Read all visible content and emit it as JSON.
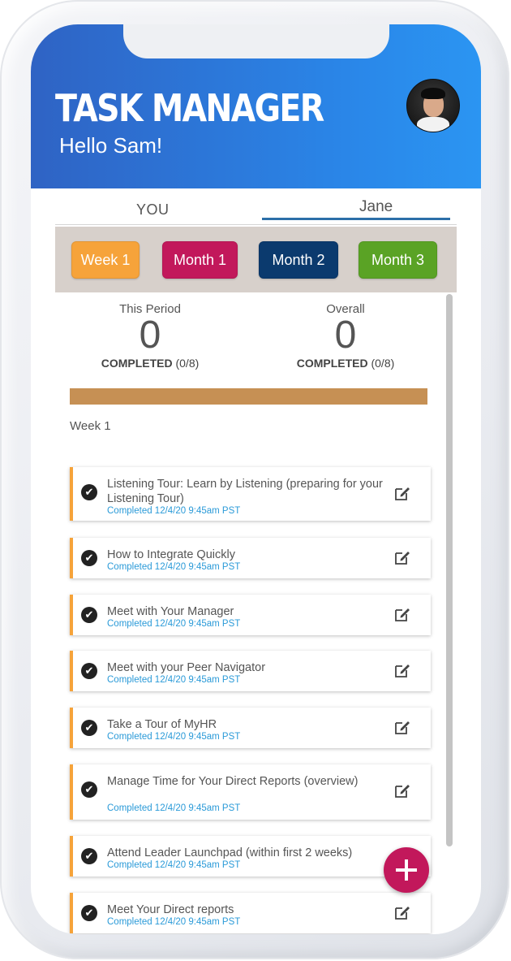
{
  "app": {
    "title": "TASK MANAGER",
    "greeting": "Hello Sam!"
  },
  "tabs": [
    {
      "label": "YOU",
      "active": false
    },
    {
      "label": "Jane",
      "active": true
    }
  ],
  "periods": [
    {
      "label": "Week 1",
      "color": "#f6a33a"
    },
    {
      "label": "Month 1",
      "color": "#c2185b"
    },
    {
      "label": "Month 2",
      "color": "#0b3a6e"
    },
    {
      "label": "Month 3",
      "color": "#5aa325"
    }
  ],
  "stats": {
    "this_period": {
      "label": "This Period",
      "value": "0",
      "completed_label": "COMPLETED",
      "completed_count": "(0/8)"
    },
    "overall": {
      "label": "Overall",
      "value": "0",
      "completed_label": "COMPLETED",
      "completed_count": "(0/8)"
    }
  },
  "progress": {
    "fraction": 0
  },
  "section": {
    "heading": "Week 1"
  },
  "tasks": [
    {
      "title": "Listening Tour: Learn by Listening (preparing for your Listening Tour)",
      "status": "Completed 12/4/20 9:45am PST"
    },
    {
      "title": "How to Integrate Quickly",
      "status": "Completed 12/4/20 9:45am PST"
    },
    {
      "title": "Meet with Your Manager",
      "status": "Completed 12/4/20 9:45am PST"
    },
    {
      "title": "Meet with your Peer Navigator",
      "status": "Completed 12/4/20 9:45am PST"
    },
    {
      "title": "Take a Tour of MyHR",
      "status": "Completed 12/4/20 9:45am PST"
    },
    {
      "title": "Manage Time for Your Direct Reports (overview)",
      "status": "Completed 12/4/20 9:45am PST"
    },
    {
      "title": "Attend Leader Launchpad (within first 2 weeks)",
      "status": "Completed 12/4/20 9:45am PST"
    },
    {
      "title": "Meet Your Direct reports",
      "status": "Completed 12/4/20 9:45am PST"
    }
  ],
  "icons": {
    "check": "check-circle-icon",
    "edit": "edit-icon",
    "add": "plus-icon"
  }
}
